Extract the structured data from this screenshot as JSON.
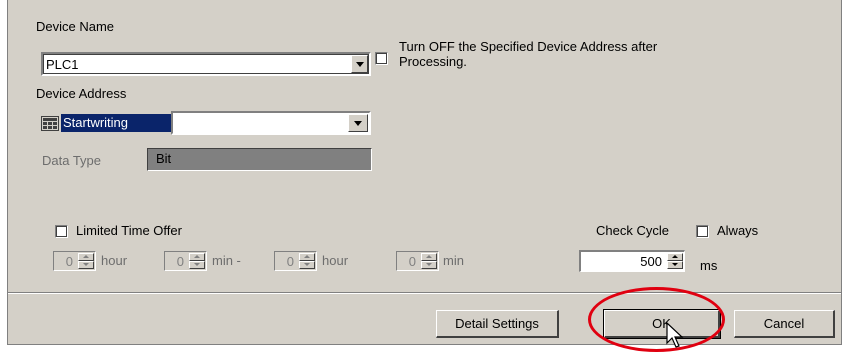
{
  "device_name": {
    "label": "Device Name",
    "value": "PLC1"
  },
  "turn_off_option": {
    "line1": "Turn OFF the Specified Device Address after",
    "line2": "Processing."
  },
  "device_address": {
    "label": "Device Address",
    "value": "Startwriting"
  },
  "data_type": {
    "label": "Data Type",
    "value": "Bit"
  },
  "limited_time": {
    "label": "Limited Time Offer",
    "fields": [
      {
        "value": "0",
        "unit": "hour"
      },
      {
        "value": "0",
        "unit": "min -"
      },
      {
        "value": "0",
        "unit": "hour"
      },
      {
        "value": "0",
        "unit": "min"
      }
    ]
  },
  "check_cycle": {
    "label": "Check Cycle",
    "always_label": "Always",
    "value": "500",
    "unit": "ms"
  },
  "buttons": {
    "detail_settings": "Detail Settings",
    "ok": "OK",
    "cancel": "Cancel"
  },
  "colors": {
    "panel": "#d4d0c8",
    "selection": "#0a246a",
    "highlight_ring": "#e00010"
  },
  "icons": [
    "device-icon",
    "dropdown-arrow-icon",
    "spin-up-icon",
    "spin-down-icon",
    "mouse-cursor-icon"
  ]
}
